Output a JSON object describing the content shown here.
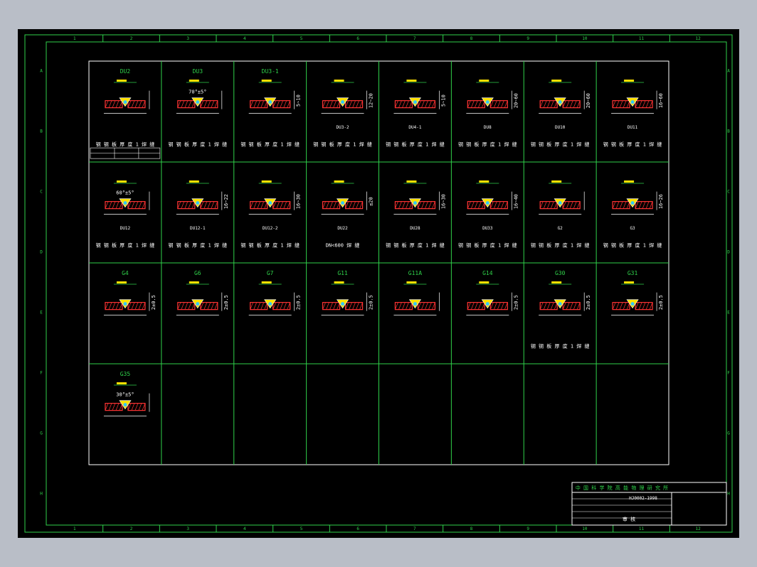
{
  "colors": {
    "background": "#b9bec7",
    "canvas": "#000000",
    "frame": "#2fd14a",
    "sheet_border": "#ffffff",
    "weld_fill": "#ffe100",
    "hatch": "#ff3333",
    "accent_blue": "#33c8ff"
  },
  "ruler": {
    "columns": [
      "1",
      "2",
      "3",
      "4",
      "5",
      "6",
      "7",
      "8",
      "9",
      "10",
      "11",
      "12"
    ],
    "rows": [
      "A",
      "B",
      "C",
      "D",
      "E",
      "F",
      "G",
      "H"
    ]
  },
  "cells": [
    {
      "title": "DU2",
      "tag": "",
      "note": "钢 钢 板 厚 度 1 焊 缝"
    },
    {
      "title": "DU3",
      "tag": "",
      "dim": "70°±5°",
      "note": "钢 钢 板 厚 度 1 焊 缝"
    },
    {
      "title": "DU3-1",
      "tag": "",
      "dim": "5~10",
      "note": "钢 钢 板 厚 度 1 焊 缝"
    },
    {
      "title": "",
      "tag": "DU3-2",
      "dim": "12~20",
      "note": "钢 钢 板 厚 度 1 焊 缝"
    },
    {
      "title": "",
      "tag": "DU4-1",
      "dim": "5~10",
      "note": "钢 钢 板 厚 度 1 焊 缝"
    },
    {
      "title": "",
      "tag": "DU8",
      "dim": "20~60",
      "note": "钢 钢 板 厚 度 1 焊 缝"
    },
    {
      "title": "",
      "tag": "DU10",
      "dim": "20~60",
      "note": "钢 钢 板 厚 度 1 焊 缝"
    },
    {
      "title": "",
      "tag": "DU11",
      "dim": "16~60",
      "note": "钢 钢 板 厚 度 1 焊 缝"
    },
    {
      "title": "",
      "tag": "DU12",
      "dim": "60°±5°",
      "note": "钢 钢 板 厚 度 1 焊 缝"
    },
    {
      "title": "",
      "tag": "DU12-1",
      "dim": "16~22",
      "note": "钢 钢 板 厚 度 1 焊 缝"
    },
    {
      "title": "",
      "tag": "DU12-2",
      "dim": "16~30",
      "note": "钢 钢 板 厚 度 1 焊 缝"
    },
    {
      "title": "",
      "tag": "DU22",
      "dim": "≤20",
      "note": "DN<600 焊 缝"
    },
    {
      "title": "",
      "tag": "DU28",
      "dim": "16~30",
      "note": "钢 钢 板 厚 度 1 焊 缝"
    },
    {
      "title": "",
      "tag": "DU33",
      "dim": "16~40",
      "note": "钢 钢 板 厚 度 1 焊 缝"
    },
    {
      "title": "",
      "tag": "G2",
      "dim": "",
      "note": "钢 钢 板 厚 度 1 焊 缝"
    },
    {
      "title": "",
      "tag": "G3",
      "dim": "16~26",
      "note": "钢 钢 板 厚 度 1 焊 缝"
    },
    {
      "title": "G4",
      "tag": "",
      "dim": "2±0.5",
      "note": ""
    },
    {
      "title": "G6",
      "tag": "",
      "dim": "2±0.5",
      "note": ""
    },
    {
      "title": "G7",
      "tag": "",
      "dim": "2±0.5",
      "note": ""
    },
    {
      "title": "G11",
      "tag": "",
      "dim": "2±0.5",
      "note": ""
    },
    {
      "title": "G11A",
      "tag": "",
      "dim": "",
      "note": ""
    },
    {
      "title": "G14",
      "tag": "",
      "dim": "2±0.5",
      "note": ""
    },
    {
      "title": "G30",
      "tag": "",
      "dim": "2±0.5",
      "note": "钢 钢 板 厚 度 1 焊 缝"
    },
    {
      "title": "G31",
      "tag": "",
      "dim": "2±0.5",
      "note": ""
    },
    {
      "title": "G35",
      "tag": "",
      "dim": "30°±5°",
      "note": ""
    }
  ],
  "title_block": {
    "org": "中 国 科 学 院 高 能 物 理 研 究 所",
    "code": "HJ0002-1998",
    "role": "审 核"
  }
}
